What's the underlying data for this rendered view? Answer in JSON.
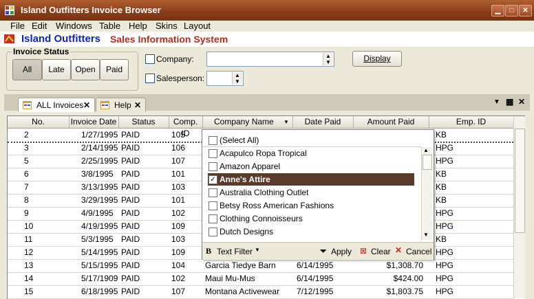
{
  "window": {
    "title": "Island Outfitters Invoice Browser"
  },
  "menu": [
    "File",
    "Edit",
    "Windows",
    "Table",
    "Help",
    "Skins",
    "Layout"
  ],
  "header": {
    "app": "Island Outfitters",
    "subtitle": "Sales Information System"
  },
  "status_group": {
    "label": "Invoice Status",
    "buttons": [
      "All",
      "Late",
      "Open",
      "Paid"
    ],
    "active": "All"
  },
  "filters": {
    "company_label": "Company:",
    "salesperson_label": "Salesperson:",
    "display_label": "Display"
  },
  "tabs": [
    {
      "label": "ALL Invoices"
    },
    {
      "label": "Help"
    }
  ],
  "grid": {
    "columns": [
      "No.",
      "Invoice Date",
      "Status",
      "Comp. ID",
      "Company Name",
      "Date Paid",
      "Amount Paid",
      "Emp. ID"
    ],
    "rows": [
      [
        "2",
        "1/27/1995",
        "PAID",
        "105",
        "",
        "",
        "",
        "KB"
      ],
      [
        "3",
        "2/14/1995",
        "PAID",
        "106",
        "",
        "",
        "",
        "HPG"
      ],
      [
        "5",
        "2/25/1995",
        "PAID",
        "107",
        "",
        "",
        "",
        "HPG"
      ],
      [
        "6",
        "3/8/1995",
        "PAID",
        "101",
        "",
        "",
        "",
        "KB"
      ],
      [
        "7",
        "3/13/1995",
        "PAID",
        "103",
        "",
        "",
        "",
        "KB"
      ],
      [
        "8",
        "3/29/1995",
        "PAID",
        "101",
        "",
        "",
        "",
        "KB"
      ],
      [
        "9",
        "4/9/1995",
        "PAID",
        "102",
        "",
        "",
        "",
        "HPG"
      ],
      [
        "10",
        "4/19/1995",
        "PAID",
        "109",
        "",
        "",
        "",
        "HPG"
      ],
      [
        "11",
        "5/3/1995",
        "PAID",
        "103",
        "",
        "",
        "",
        "KB"
      ],
      [
        "12",
        "5/14/1995",
        "PAID",
        "109",
        "",
        "",
        "",
        "HPG"
      ],
      [
        "13",
        "5/15/1995",
        "PAID",
        "104",
        "Garcia Tiedye Barn",
        "6/14/1995",
        "$1,308.70",
        "HPG"
      ],
      [
        "14",
        "5/17/1909",
        "PAID",
        "102",
        "Maui  Mu-Mus",
        "6/14/1995",
        "$424.00",
        "HPG"
      ],
      [
        "15",
        "6/18/1995",
        "PAID",
        "107",
        "Montana Activewear",
        "7/12/1995",
        "$1,803.75",
        "HPG"
      ]
    ]
  },
  "filter_popup": {
    "items": [
      {
        "label": "(Select All)",
        "checked": false
      },
      {
        "label": "Acapulco Ropa Tropical",
        "checked": false
      },
      {
        "label": "Amazon Apparel",
        "checked": false
      },
      {
        "label": "Anne's Attire",
        "checked": true,
        "selected": true
      },
      {
        "label": "Australia Clothing Outlet",
        "checked": false
      },
      {
        "label": "Betsy Ross American Fashions",
        "checked": false
      },
      {
        "label": "Clothing Connoisseurs",
        "checked": false
      },
      {
        "label": "Dutch Designs",
        "checked": false
      }
    ],
    "text_filter_label": "Text Filter",
    "apply_label": "Apply",
    "clear_label": "Clear",
    "cancel_label": "Cancel"
  },
  "colors": {
    "title_bar": "#8a3d1a",
    "app_name": "#1025b8",
    "subtitle": "#c0281c",
    "selected_item": "#5a3a2a"
  }
}
